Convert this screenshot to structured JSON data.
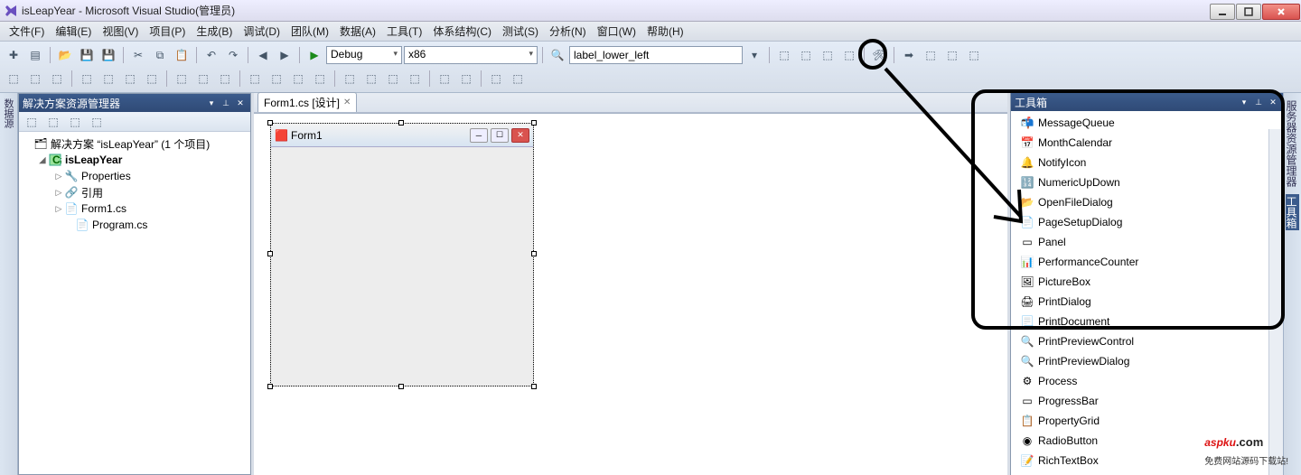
{
  "window": {
    "title": "isLeapYear - Microsoft Visual Studio(管理员)"
  },
  "menu": {
    "file": "文件(F)",
    "edit": "编辑(E)",
    "view": "视图(V)",
    "project": "项目(P)",
    "build": "生成(B)",
    "debug": "调试(D)",
    "team": "团队(M)",
    "data": "数据(A)",
    "tools": "工具(T)",
    "arch": "体系结构(C)",
    "test": "测试(S)",
    "analyze": "分析(N)",
    "window": "窗口(W)",
    "help": "帮助(H)"
  },
  "toolbar": {
    "config": "Debug",
    "platform": "x86",
    "find": "label_lower_left"
  },
  "solution_explorer": {
    "title": "解决方案资源管理器",
    "solution": "解决方案 “isLeapYear” (1 个项目)",
    "project": "isLeapYear",
    "nodes": {
      "properties": "Properties",
      "references": "引用",
      "form": "Form1.cs",
      "program": "Program.cs"
    }
  },
  "dock_tabs": {
    "left": "数据源",
    "right_server": "服务器资源管理器",
    "right_toolbox": "工具箱"
  },
  "doc_tabs": {
    "form_designer": "Form1.cs [设计]"
  },
  "form": {
    "title": "Form1"
  },
  "toolbox": {
    "title": "工具箱",
    "items": [
      "MessageQueue",
      "MonthCalendar",
      "NotifyIcon",
      "NumericUpDown",
      "OpenFileDialog",
      "PageSetupDialog",
      "Panel",
      "PerformanceCounter",
      "PictureBox",
      "PrintDialog",
      "PrintDocument",
      "PrintPreviewControl",
      "PrintPreviewDialog",
      "Process",
      "ProgressBar",
      "PropertyGrid",
      "RadioButton",
      "RichTextBox"
    ]
  },
  "watermark": {
    "brand": "aspku",
    "dot": ".com",
    "sub": "免费网站源码下载站!"
  }
}
